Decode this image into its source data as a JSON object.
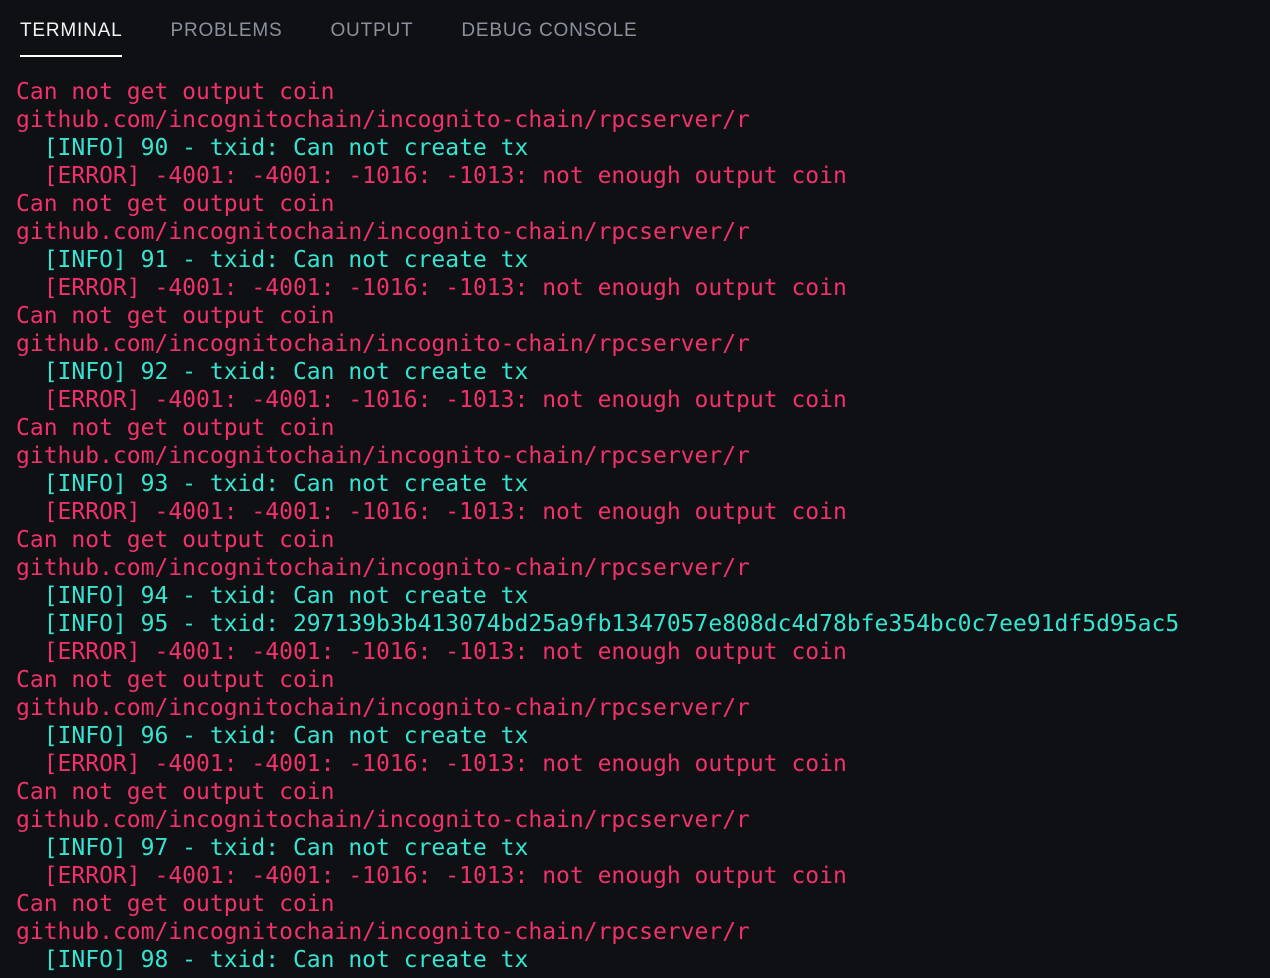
{
  "colors": {
    "background": "#0e1014",
    "pink": "#f0316a",
    "cyan": "#36e4d0",
    "tab_inactive": "#8b919b",
    "tab_active": "#f2f3f5",
    "active_tab_underline": "#ffffff"
  },
  "panel_tabs": {
    "items": [
      {
        "label": "TERMINAL",
        "active": true
      },
      {
        "label": "PROBLEMS",
        "active": false
      },
      {
        "label": "OUTPUT",
        "active": false
      },
      {
        "label": "DEBUG CONSOLE",
        "active": false
      }
    ]
  },
  "terminal": {
    "lines": [
      {
        "text": "Can not get output coin",
        "color": "pink"
      },
      {
        "text": "github.com/incognitochain/incognito-chain/rpcserver/r",
        "color": "pink"
      },
      {
        "text": "  [INFO] 90 - txid: Can not create tx",
        "color": "cyan"
      },
      {
        "text": "  [ERROR] -4001: -4001: -1016: -1013: not enough output coin",
        "color": "pink"
      },
      {
        "text": "Can not get output coin",
        "color": "pink"
      },
      {
        "text": "github.com/incognitochain/incognito-chain/rpcserver/r",
        "color": "pink"
      },
      {
        "text": "  [INFO] 91 - txid: Can not create tx",
        "color": "cyan"
      },
      {
        "text": "  [ERROR] -4001: -4001: -1016: -1013: not enough output coin",
        "color": "pink"
      },
      {
        "text": "Can not get output coin",
        "color": "pink"
      },
      {
        "text": "github.com/incognitochain/incognito-chain/rpcserver/r",
        "color": "pink"
      },
      {
        "text": "  [INFO] 92 - txid: Can not create tx",
        "color": "cyan"
      },
      {
        "text": "  [ERROR] -4001: -4001: -1016: -1013: not enough output coin",
        "color": "pink"
      },
      {
        "text": "Can not get output coin",
        "color": "pink"
      },
      {
        "text": "github.com/incognitochain/incognito-chain/rpcserver/r",
        "color": "pink"
      },
      {
        "text": "  [INFO] 93 - txid: Can not create tx",
        "color": "cyan"
      },
      {
        "text": "  [ERROR] -4001: -4001: -1016: -1013: not enough output coin",
        "color": "pink"
      },
      {
        "text": "Can not get output coin",
        "color": "pink"
      },
      {
        "text": "github.com/incognitochain/incognito-chain/rpcserver/r",
        "color": "pink"
      },
      {
        "text": "  [INFO] 94 - txid: Can not create tx",
        "color": "cyan"
      },
      {
        "text": "  [INFO] 95 - txid: 297139b3b413074bd25a9fb1347057e808dc4d78bfe354bc0c7ee91df5d95ac5",
        "color": "cyan"
      },
      {
        "text": "  [ERROR] -4001: -4001: -1016: -1013: not enough output coin",
        "color": "pink"
      },
      {
        "text": "Can not get output coin",
        "color": "pink"
      },
      {
        "text": "github.com/incognitochain/incognito-chain/rpcserver/r",
        "color": "pink"
      },
      {
        "text": "  [INFO] 96 - txid: Can not create tx",
        "color": "cyan"
      },
      {
        "text": "  [ERROR] -4001: -4001: -1016: -1013: not enough output coin",
        "color": "pink"
      },
      {
        "text": "Can not get output coin",
        "color": "pink"
      },
      {
        "text": "github.com/incognitochain/incognito-chain/rpcserver/r",
        "color": "pink"
      },
      {
        "text": "  [INFO] 97 - txid: Can not create tx",
        "color": "cyan"
      },
      {
        "text": "  [ERROR] -4001: -4001: -1016: -1013: not enough output coin",
        "color": "pink"
      },
      {
        "text": "Can not get output coin",
        "color": "pink"
      },
      {
        "text": "github.com/incognitochain/incognito-chain/rpcserver/r",
        "color": "pink"
      },
      {
        "text": "  [INFO] 98 - txid: Can not create tx",
        "color": "cyan"
      }
    ]
  }
}
